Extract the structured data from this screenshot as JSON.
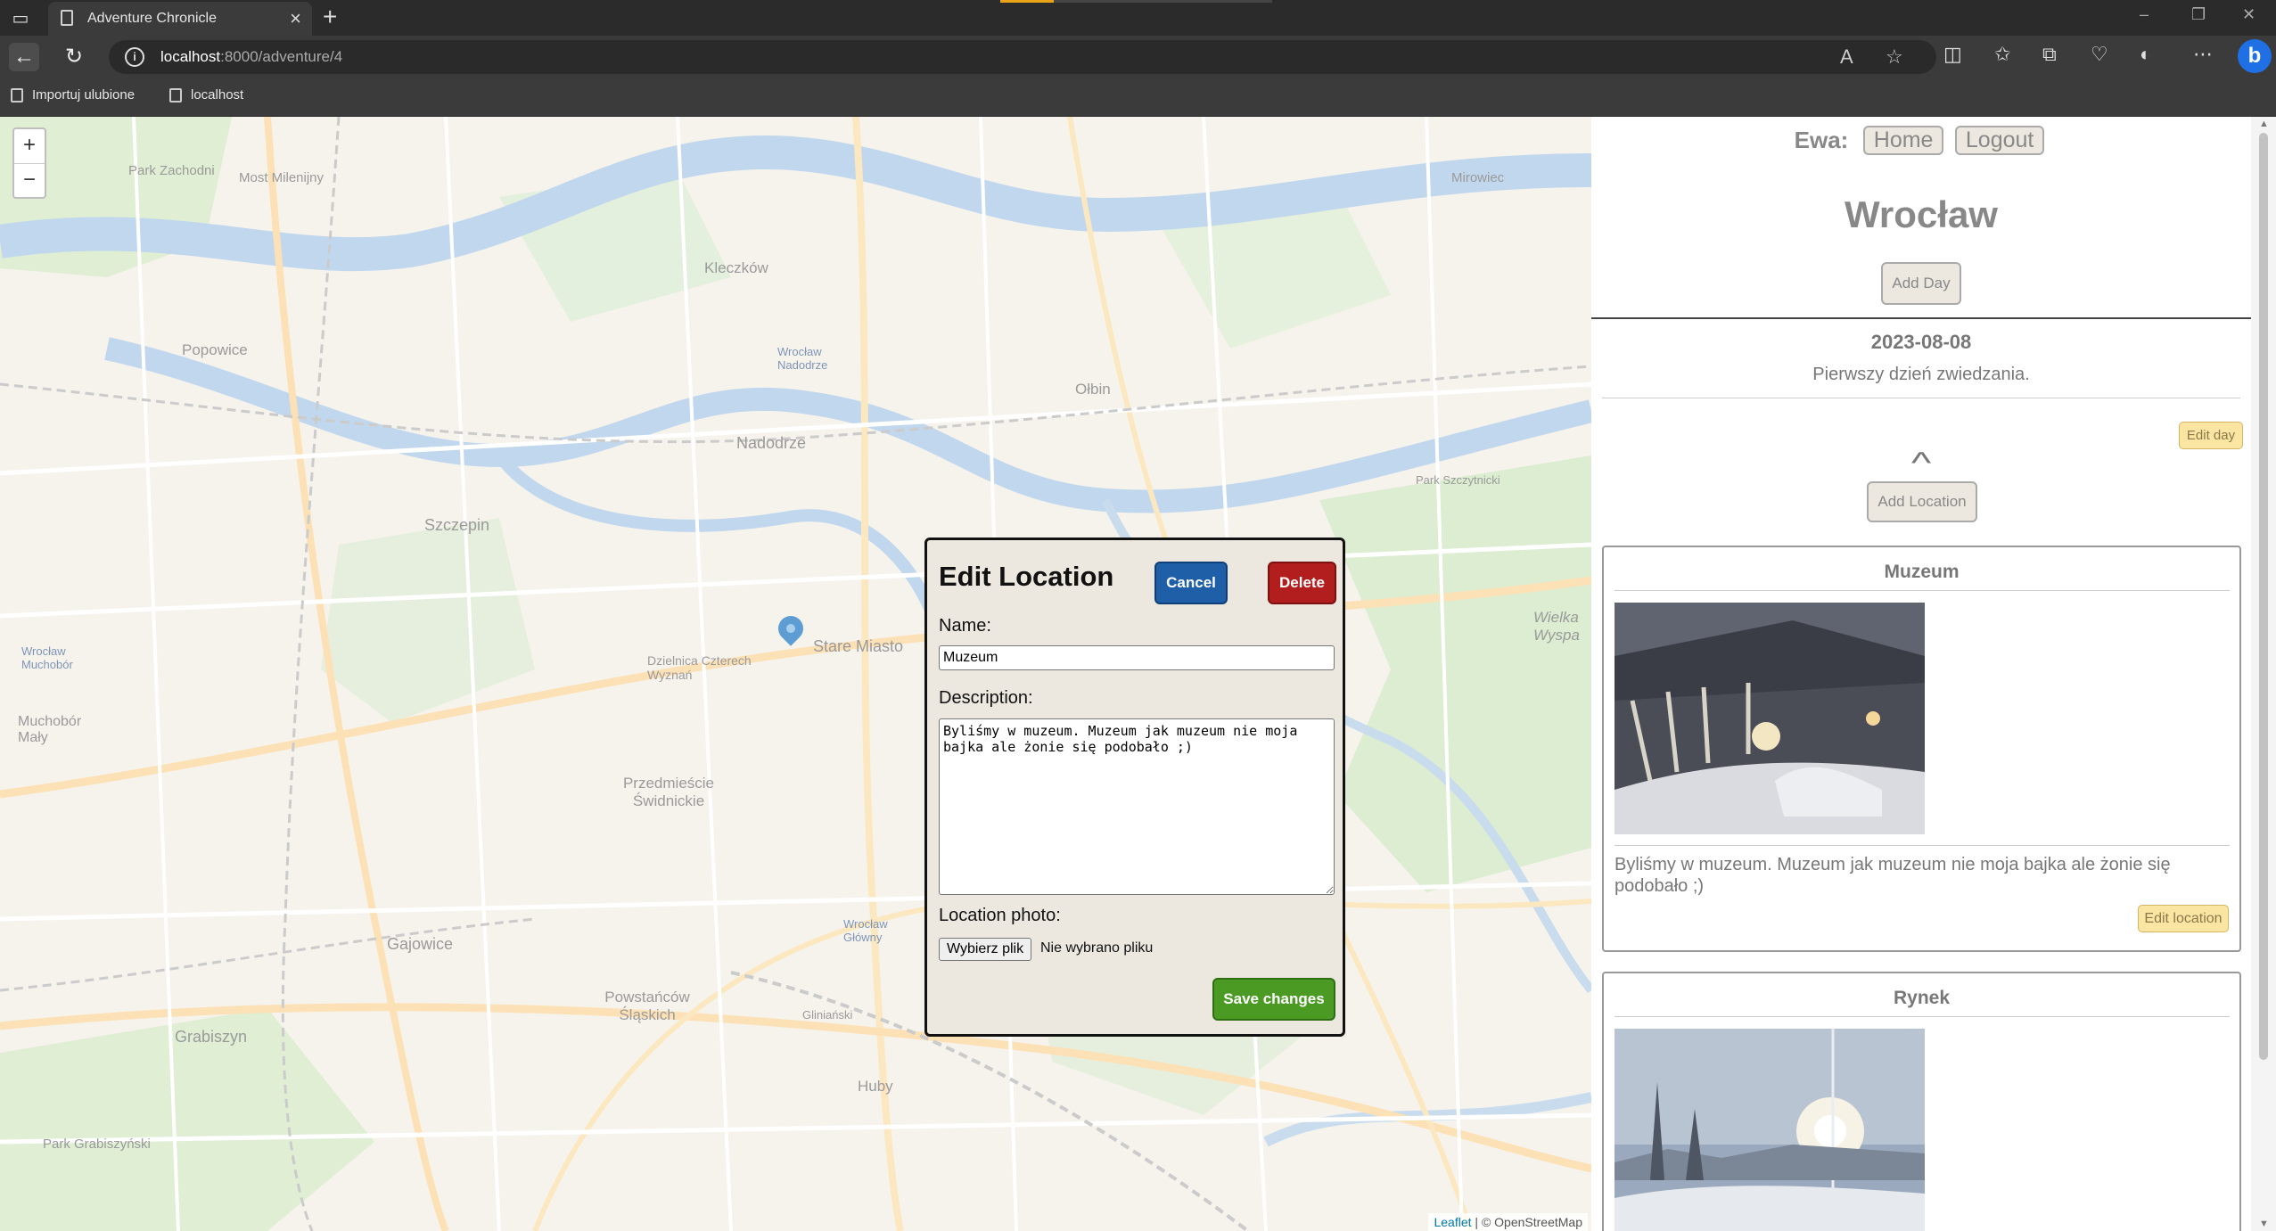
{
  "browser": {
    "tab_title": "Adventure Chronicle",
    "new_tab": "+",
    "url_host": "localhost",
    "url_path": ":8000/adventure/4",
    "window_controls": [
      "–",
      "❐",
      "✕"
    ],
    "bookmarks": [
      "Importuj ulubione",
      "localhost"
    ]
  },
  "map": {
    "zoom_in": "+",
    "zoom_out": "−",
    "labels": [
      "Most Milenijny",
      "Park Zachodni",
      "Kleczków",
      "Nadodrze",
      "Szczepin",
      "Popowice",
      "Muchobór Mały",
      "Stare Miasto",
      "Przedmieście Świdnickie",
      "Gajowice",
      "Powstańców Śląskich",
      "Grabiszyn",
      "Park Grabiszyński",
      "Huby",
      "Ołbin",
      "Mirowiec",
      "Wielka Wyspa",
      "Dzielnica Czterech Wyznań",
      "Wrocław Główny",
      "Wrocław Nadodrze",
      "Wrocław Muchobór",
      "Gliniański",
      "Park Szczytnicki"
    ],
    "attrib_leaflet": "Leaflet",
    "attrib_osm": "| © OpenStreetMap"
  },
  "modal": {
    "title": "Edit Location",
    "cancel": "Cancel",
    "delete": "Delete",
    "name_label": "Name:",
    "name_value": "Muzeum",
    "description_label": "Description:",
    "description_value": "Byliśmy w muzeum. Muzeum jak muzeum nie moja bajka ale żonie się podobało ;)",
    "photo_label": "Location photo:",
    "file_button": "Wybierz plik",
    "file_status": "Nie wybrano pliku",
    "save": "Save changes"
  },
  "sidebar": {
    "user": "Ewa:",
    "home": "Home",
    "logout": "Logout",
    "adventure_title": "Wrocław",
    "add_day": "Add Day",
    "day": {
      "date": "2023-08-08",
      "description": "Pierwszy dzień zwiedzania.",
      "edit_day": "Edit day",
      "collapse": "^",
      "add_location": "Add Location"
    },
    "locations": [
      {
        "name": "Muzeum",
        "description": "Byliśmy w muzeum. Muzeum jak muzeum nie moja bajka ale żonie się podobało ;)",
        "edit": "Edit location"
      },
      {
        "name": "Rynek"
      }
    ]
  }
}
